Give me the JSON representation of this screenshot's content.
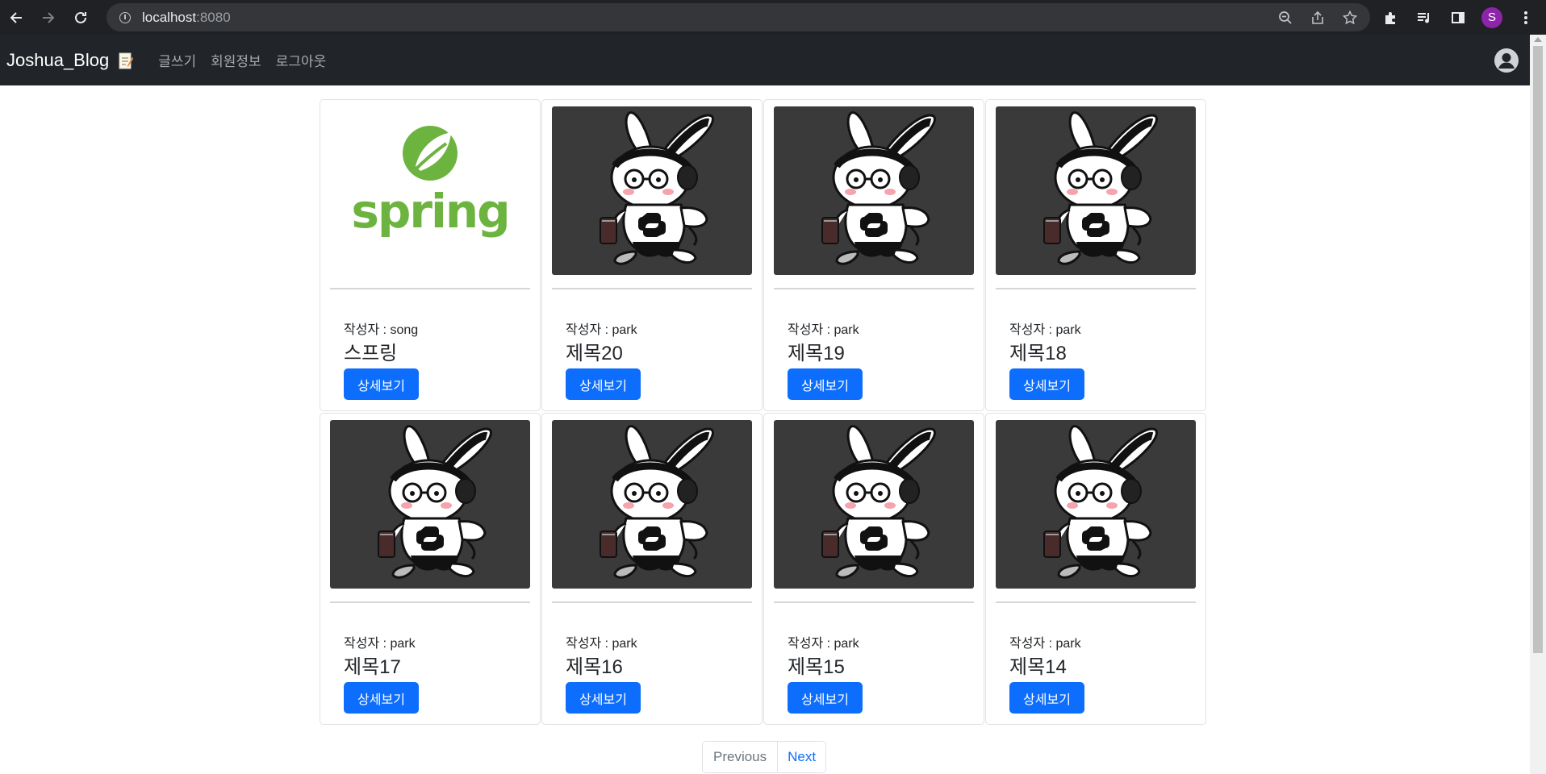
{
  "browser": {
    "url_host": "localhost",
    "url_port": ":8080",
    "profile_initial": "S"
  },
  "navbar": {
    "brand": "Joshua_Blog",
    "links": [
      "글쓰기",
      "회원정보",
      "로그아웃"
    ]
  },
  "posts": [
    {
      "author": "작성자 : song",
      "title": "스프링",
      "button": "상세보기",
      "image": "spring-logo"
    },
    {
      "author": "작성자 : park",
      "title": "제목20",
      "button": "상세보기",
      "image": "rabbit-illustration"
    },
    {
      "author": "작성자 : park",
      "title": "제목19",
      "button": "상세보기",
      "image": "rabbit-illustration"
    },
    {
      "author": "작성자 : park",
      "title": "제목18",
      "button": "상세보기",
      "image": "rabbit-illustration"
    },
    {
      "author": "작성자 : park",
      "title": "제목17",
      "button": "상세보기",
      "image": "rabbit-illustration"
    },
    {
      "author": "작성자 : park",
      "title": "제목16",
      "button": "상세보기",
      "image": "rabbit-illustration"
    },
    {
      "author": "작성자 : park",
      "title": "제목15",
      "button": "상세보기",
      "image": "rabbit-illustration"
    },
    {
      "author": "작성자 : park",
      "title": "제목14",
      "button": "상세보기",
      "image": "rabbit-illustration"
    }
  ],
  "pagination": {
    "previous": "Previous",
    "next": "Next"
  },
  "colors": {
    "navbar_bg": "#212529",
    "primary": "#0d6efd",
    "spring_green": "#6db33f",
    "card_image_bg": "#3a3a3a"
  }
}
